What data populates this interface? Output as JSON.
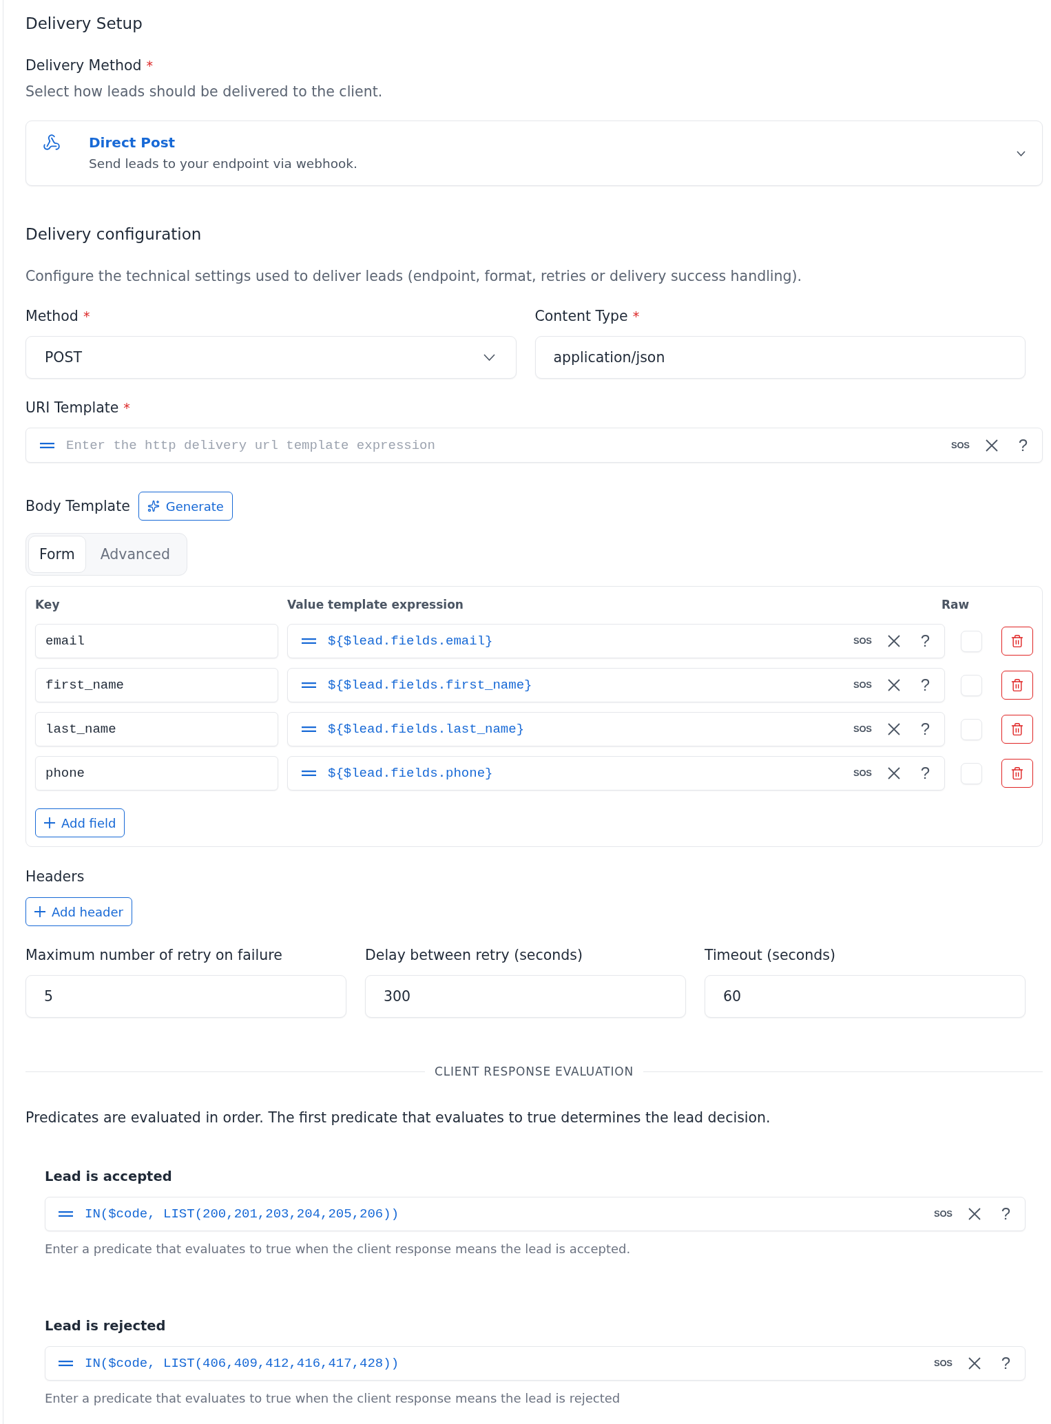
{
  "page_title": "Delivery Setup",
  "delivery_method": {
    "label": "Delivery Method",
    "required_mark": "*",
    "description": "Select how leads should be delivered to the client.",
    "selection": {
      "title": "Direct Post",
      "subtitle": "Send leads to your endpoint via webhook."
    }
  },
  "delivery_configuration": {
    "title": "Delivery configuration",
    "description": "Configure the technical settings used to deliver leads (endpoint, format, retries or delivery success handling).",
    "method": {
      "label": "Method",
      "required_mark": "*",
      "value": "POST"
    },
    "content_type": {
      "label": "Content Type",
      "required_mark": "*",
      "value": "application/json"
    },
    "uri_template": {
      "label": "URI Template",
      "required_mark": "*",
      "placeholder": "Enter the http delivery url template expression",
      "sos": "SOS",
      "help": "?"
    },
    "body_template": {
      "label": "Body Template",
      "generate_button": "Generate",
      "tabs": [
        {
          "label": "Form",
          "selected": true
        },
        {
          "label": "Advanced",
          "selected": false
        }
      ],
      "columns": [
        "Key",
        "Value template expression",
        "Raw"
      ],
      "rows": [
        {
          "key": "email",
          "value": "${$lead.fields.email}",
          "sos": "SOS",
          "help": "?",
          "raw": false
        },
        {
          "key": "first_name",
          "value": "${$lead.fields.first_name}",
          "sos": "SOS",
          "help": "?",
          "raw": false
        },
        {
          "key": "last_name",
          "value": "${$lead.fields.last_name}",
          "sos": "SOS",
          "help": "?",
          "raw": false
        },
        {
          "key": "phone",
          "value": "${$lead.fields.phone}",
          "sos": "SOS",
          "help": "?",
          "raw": false
        }
      ],
      "add_button": "Add field"
    },
    "headers": {
      "label": "Headers",
      "add_button": "Add header"
    },
    "retry_settings": [
      {
        "label": "Maximum number of retry on failure",
        "value": "5"
      },
      {
        "label": "Delay between retry (seconds)",
        "value": "300"
      },
      {
        "label": "Timeout (seconds)",
        "value": "60"
      }
    ]
  },
  "client_response_evaluation": {
    "divider_label": "CLIENT RESPONSE EVALUATION",
    "description": "Predicates are evaluated in order. The first predicate that evaluates to true determines the lead decision.",
    "predicates": [
      {
        "label": "Lead is accepted",
        "value": "IN($code, LIST(200,201,203,204,205,206))",
        "sos": "SOS",
        "help": "?",
        "hint": "Enter a predicate that evaluates to true when the client response means the lead is accepted."
      },
      {
        "label": "Lead is rejected",
        "value": "IN($code, LIST(406,409,412,416,417,428))",
        "sos": "SOS",
        "help": "?",
        "hint": "Enter a predicate that evaluates to true when the client response means the lead is rejected"
      }
    ]
  }
}
